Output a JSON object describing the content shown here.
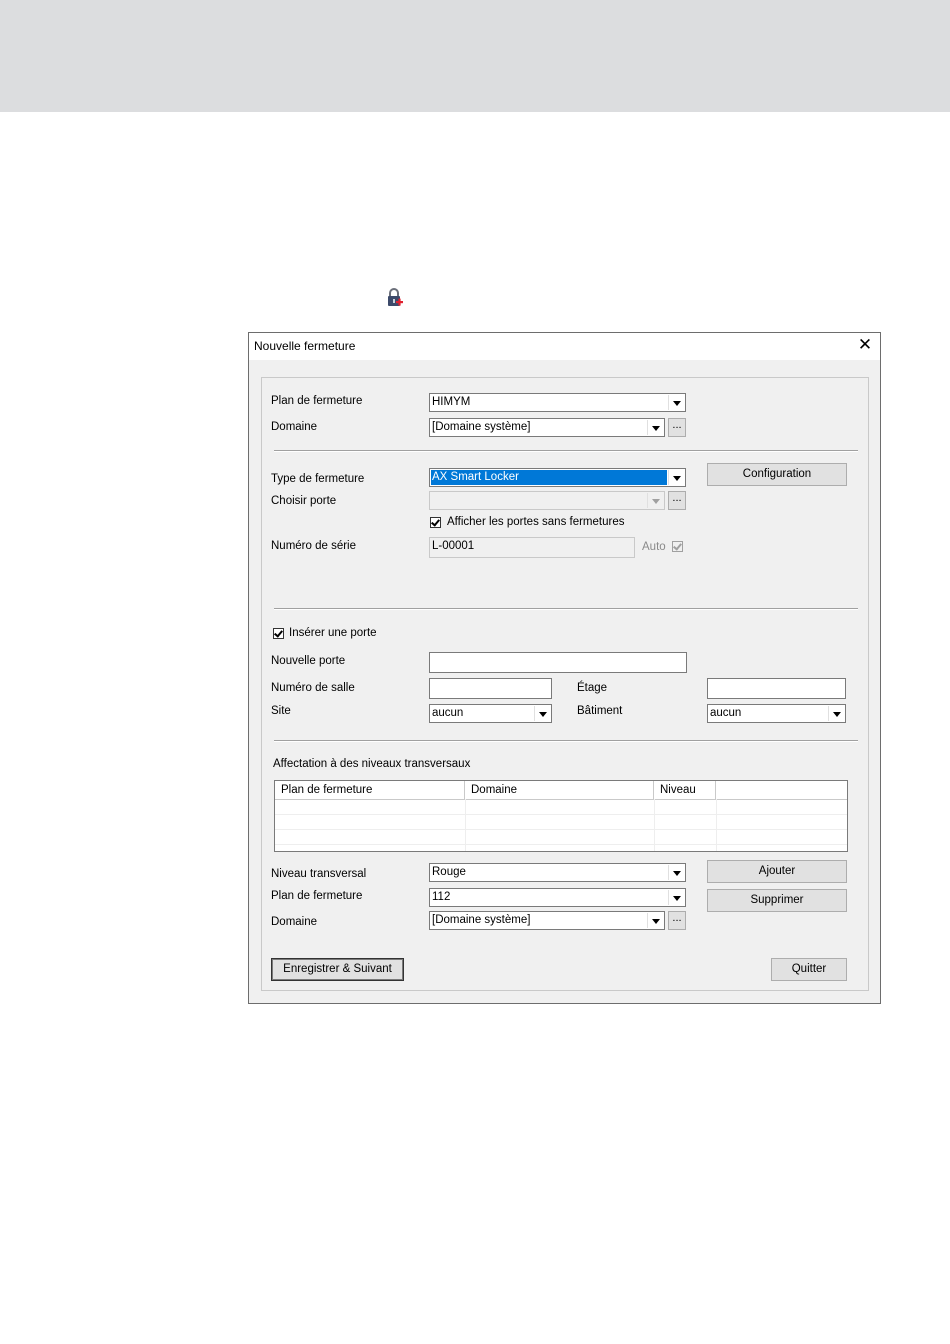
{
  "dialog": {
    "title": "Nouvelle fermeture",
    "close_glyph": "✕"
  },
  "top": {
    "plan_label": "Plan de fermeture",
    "plan_value": "HIMYM",
    "domaine_label": "Domaine",
    "domaine_value": "[Domaine système]",
    "dots": "..."
  },
  "lock": {
    "type_label": "Type de fermeture",
    "type_value": "AX Smart Locker",
    "config_button": "Configuration",
    "porte_label": "Choisir porte",
    "porte_value": "",
    "show_doors_label": "Afficher les portes sans fermetures",
    "serial_label": "Numéro de série",
    "serial_value": "L-00001",
    "auto_label": "Auto"
  },
  "door": {
    "insert_label": "Insérer une porte",
    "nouvelle_label": "Nouvelle porte",
    "nouvelle_value": "",
    "salle_label": "Numéro de salle",
    "salle_value": "",
    "etage_label": "Étage",
    "etage_value": "",
    "site_label": "Site",
    "site_value": "aucun",
    "batiment_label": "Bâtiment",
    "batiment_value": "aucun"
  },
  "transversal": {
    "section_label": "Affectation à des niveaux transversaux",
    "columns": [
      "Plan de fermeture",
      "Domaine",
      "Niveau",
      ""
    ],
    "niveau_label": "Niveau transversal",
    "niveau_value": "Rouge",
    "plan_label": "Plan de fermeture",
    "plan_value": "112",
    "domaine_label": "Domaine",
    "domaine_value": "[Domaine système]",
    "ajouter_button": "Ajouter",
    "supprimer_button": "Supprimer"
  },
  "footer": {
    "save_next_button": "Enregistrer & Suivant",
    "quit_button": "Quitter"
  },
  "icons": {
    "lock_add": "lock-add-icon",
    "close": "close-icon",
    "dropdown": "chevron-down-icon"
  }
}
